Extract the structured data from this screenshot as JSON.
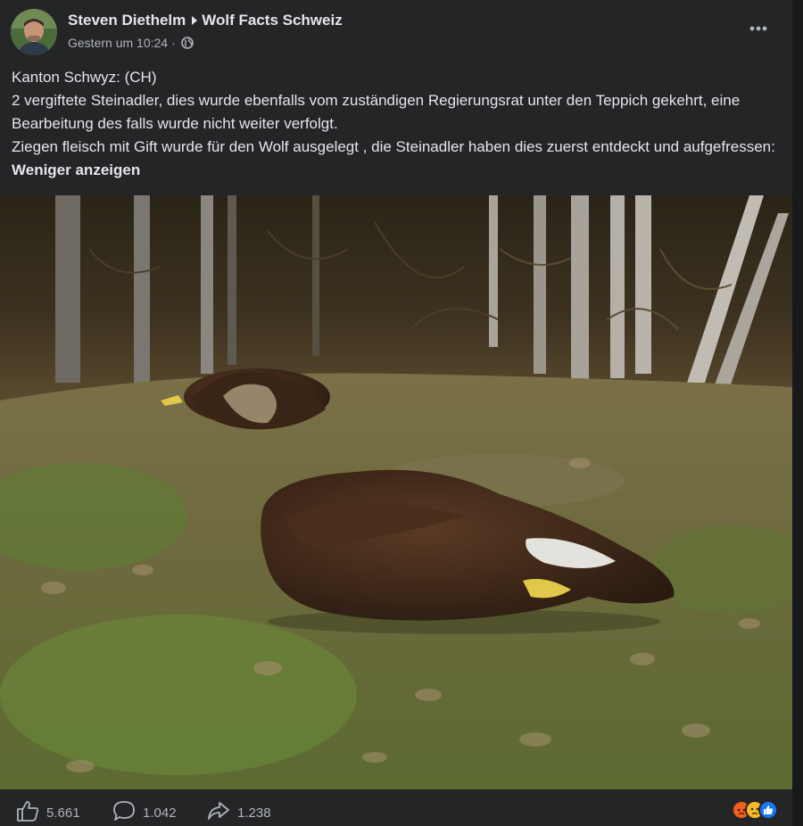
{
  "post": {
    "author": "Steven Diethelm",
    "group": "Wolf Facts Schweiz",
    "timestamp": "Gestern um 10:24",
    "separator": "·",
    "privacy_icon": "globe-icon",
    "more_icon": "more-dots-icon",
    "text": {
      "line1": "Kanton Schwyz: (CH)",
      "line2": "2 vergiftete Steinadler, dies wurde ebenfalls vom zuständigen Regierungsrat unter den Teppich gekehrt, eine Bearbeitung des falls wurde nicht weiter verfolgt.",
      "line3": "Ziegen fleisch mit Gift wurde für den Wolf ausgelegt , die Steinadler haben dies  zuerst entdeckt und aufgefressen:",
      "see_less": "Weniger anzeigen"
    },
    "photo": {
      "subject": "two dead golden eagles lying on grass at the edge of a forest"
    }
  },
  "footer": {
    "likes": "5.661",
    "comments": "1.042",
    "shares": "1.238",
    "like_icon": "thumbs-up-icon",
    "comment_icon": "comment-icon",
    "share_icon": "share-icon",
    "reactions": [
      "angry-reaction-icon",
      "sad-reaction-icon",
      "like-reaction-icon"
    ]
  },
  "colors": {
    "card_bg": "#242526",
    "page_bg": "#18191a",
    "primary_text": "#e4e6eb",
    "secondary_text": "#b0b3b8",
    "like_blue": "#1877f2",
    "angry_orange": "#f25d22",
    "sad_yellow": "#f7b928"
  }
}
